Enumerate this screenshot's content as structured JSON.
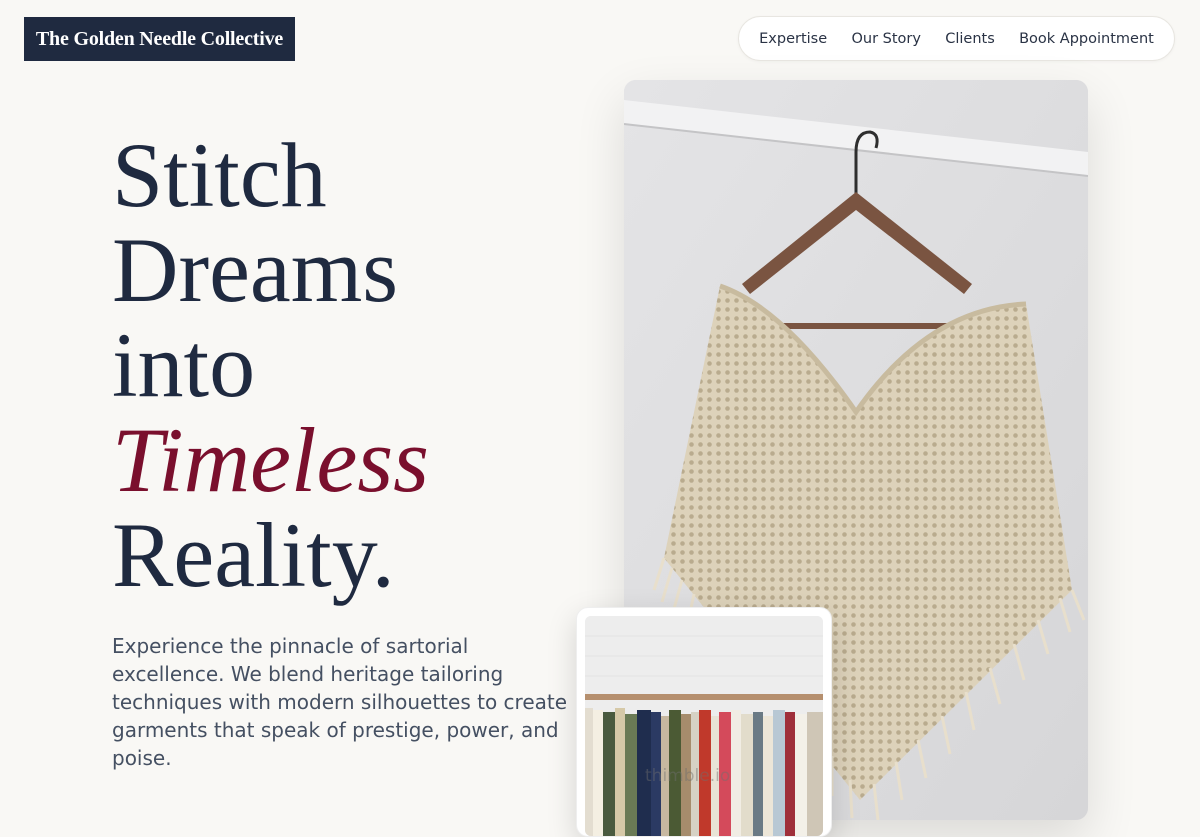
{
  "brand": {
    "name": "The Golden Needle Collective",
    "color": "#1f2a40"
  },
  "nav": {
    "items": [
      "Expertise",
      "Our Story",
      "Clients",
      "Book Appointment"
    ]
  },
  "hero": {
    "headline_lines": [
      "Stitch",
      "Dreams",
      "into"
    ],
    "headline_accent": "Timeless",
    "headline_end": "Reality.",
    "accent_color": "#7a0f2d",
    "description": "Experience the pinnacle of sartorial excellence. We blend heritage tailoring techniques with modern silhouettes to create garments that speak of prestige, power, and poise."
  },
  "images": {
    "main": "crochet-poncho-on-hanger",
    "thumbnail": "clothing-rack",
    "thumbnail_watermark": "thimble.io"
  }
}
